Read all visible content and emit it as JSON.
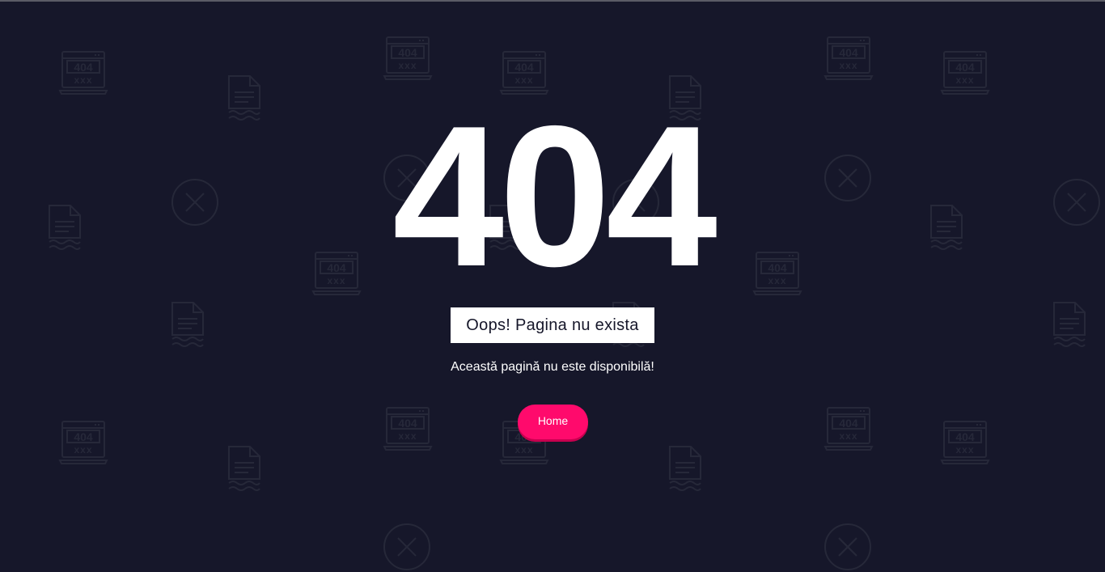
{
  "page": {
    "error_code": "404",
    "heading": "Oops! Pagina nu exista",
    "message": "Această pagină nu este disponibilă!",
    "home_button": "Home"
  },
  "background_pattern": {
    "icon_types": [
      "laptop-404-icon",
      "document-icon",
      "close-circle-icon"
    ],
    "laptop_screen_text": "404",
    "laptop_sub_text": "xxx"
  },
  "colors": {
    "background": "#16172a",
    "pattern_icon": "#262839",
    "text": "#ffffff",
    "accent": "#ff0a6c"
  }
}
